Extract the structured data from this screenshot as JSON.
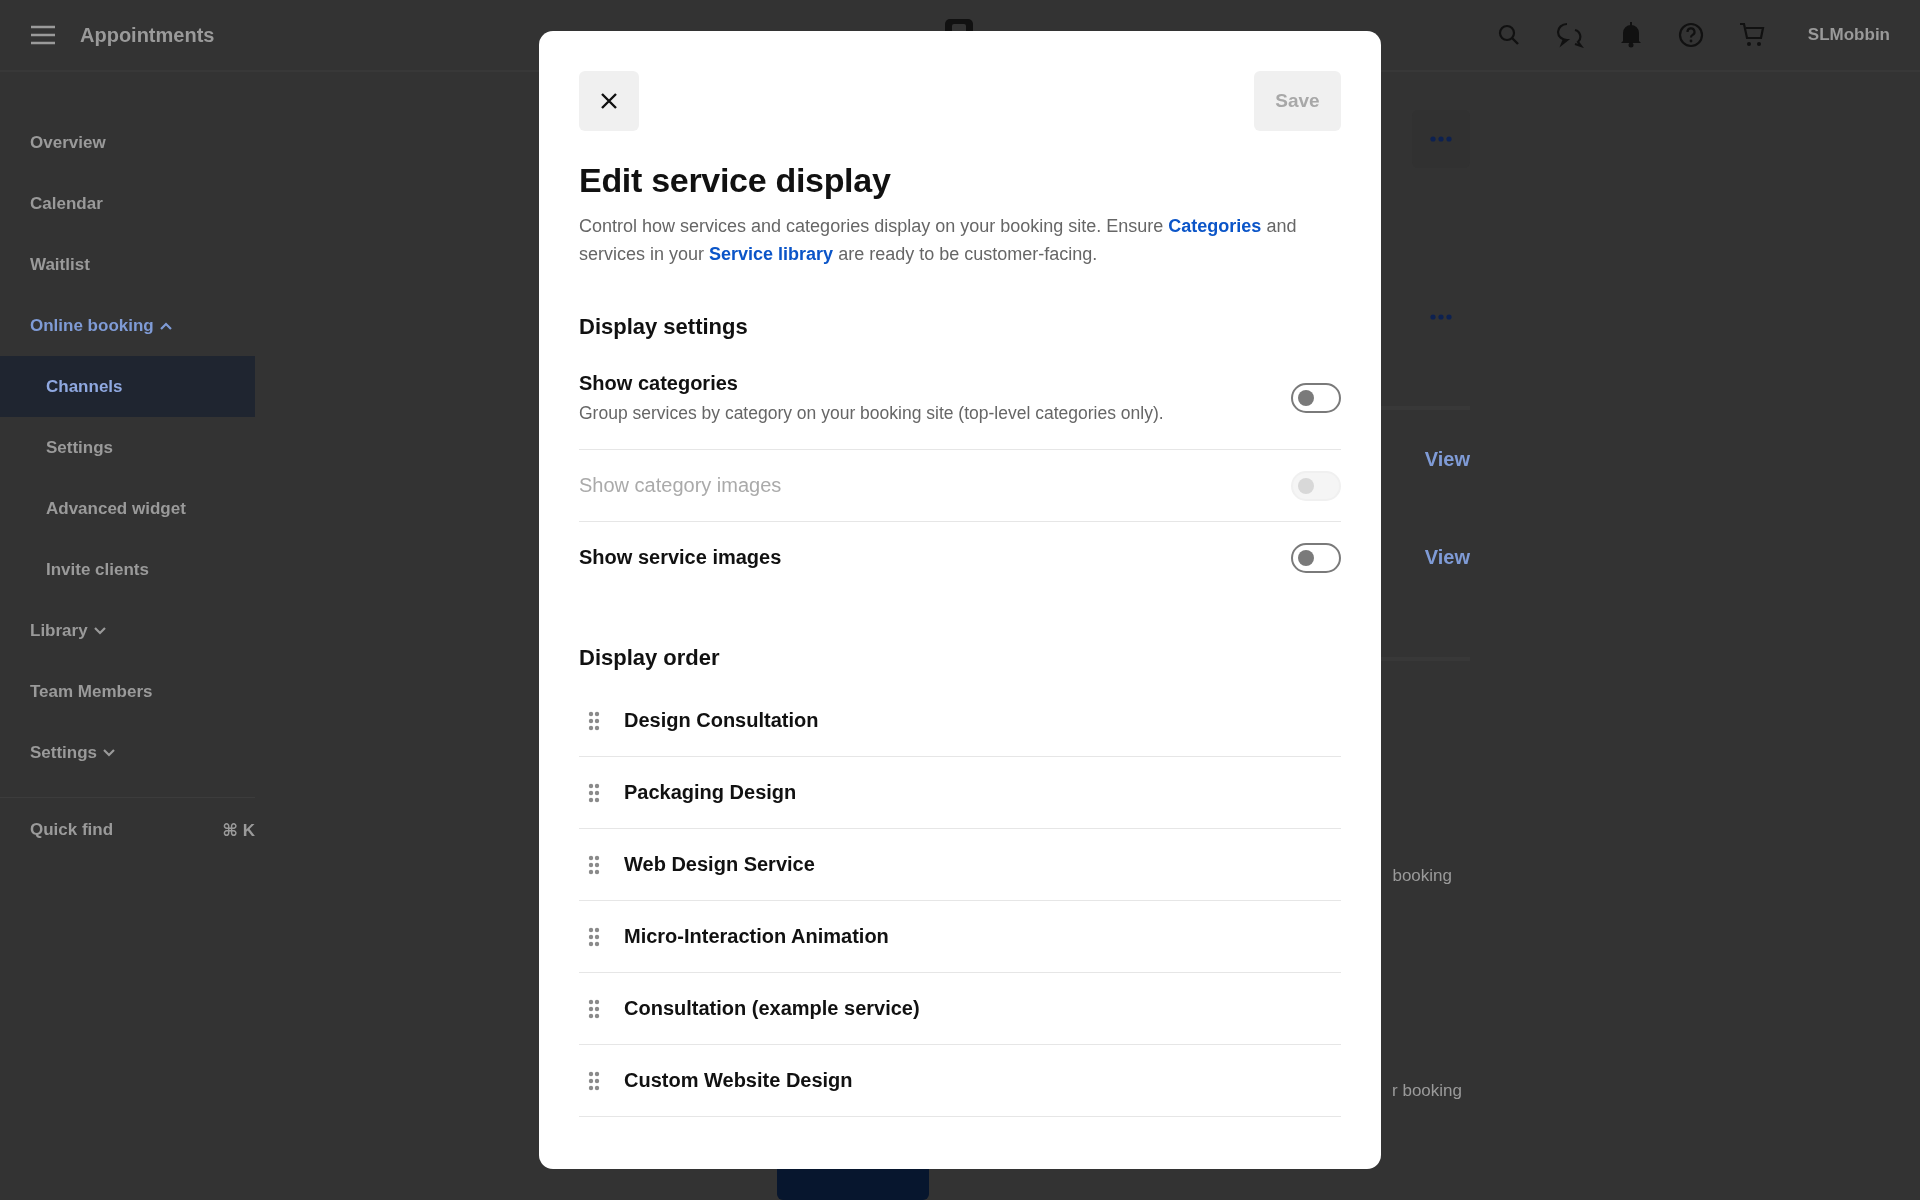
{
  "top_bar": {
    "title": "Appointments",
    "user": "SLMobbin"
  },
  "sidebar": {
    "items": [
      {
        "label": "Overview",
        "kind": "link",
        "selected": false
      },
      {
        "label": "Calendar",
        "kind": "link",
        "selected": false
      },
      {
        "label": "Waitlist",
        "kind": "link",
        "selected": false
      },
      {
        "label": "Online booking",
        "kind": "group",
        "selected": false,
        "expanded": true,
        "children": [
          {
            "label": "Channels",
            "selected": true
          },
          {
            "label": "Settings",
            "selected": false
          },
          {
            "label": "Advanced widget",
            "selected": false
          },
          {
            "label": "Invite clients",
            "selected": false
          }
        ]
      },
      {
        "label": "Library",
        "kind": "group",
        "selected": false,
        "expanded": false
      },
      {
        "label": "Team Members",
        "kind": "link",
        "selected": false
      },
      {
        "label": "Settings",
        "kind": "group",
        "selected": false,
        "expanded": false
      }
    ],
    "quick_find": {
      "label": "Quick find",
      "shortcut": "⌘ K"
    }
  },
  "background": {
    "links": [
      "View",
      "View"
    ],
    "texts": [
      "booking",
      "r booking"
    ]
  },
  "dialog": {
    "save_button": {
      "label": "Save",
      "disabled": true
    },
    "title": "Edit service display",
    "description": [
      {
        "kind": "text",
        "text": "Control how services and categories display on your booking site. Ensure "
      },
      {
        "kind": "link",
        "text": "Categories"
      },
      {
        "kind": "text",
        "text": " and services in your "
      },
      {
        "kind": "link",
        "text": "Service library"
      },
      {
        "kind": "text",
        "text": " are ready to be customer-facing."
      }
    ],
    "settings_heading": "Display settings",
    "toggles": [
      {
        "label": "Show categories",
        "description": "Group services by category on your booking site (top-level categories only).",
        "on": false,
        "disabled": false
      },
      {
        "label": "Show category images",
        "on": false,
        "disabled": true
      },
      {
        "label": "Show service images",
        "on": false,
        "disabled": false
      }
    ],
    "order_heading": "Display order",
    "order": [
      "Design Consultation",
      "Packaging Design",
      "Web Design Service",
      "Micro-Interaction Animation",
      "Consultation (example service)",
      "Custom Website Design"
    ]
  }
}
